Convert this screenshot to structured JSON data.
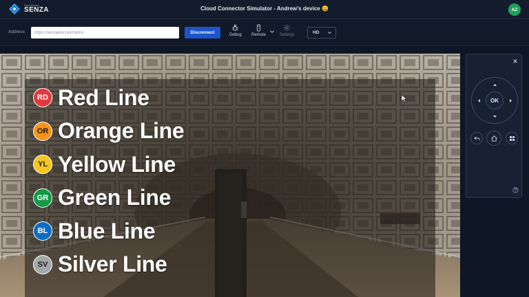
{
  "app": {
    "brand_small": "Synamedia",
    "brand": "SENZA",
    "title": "Cloud Connector Simulator - Andrew's device 😀",
    "user_initials": "AZ"
  },
  "toolbar": {
    "address_label": "Address",
    "address_value": "https://senzadev.net/metro/",
    "disconnect_label": "Disconnect",
    "debug_label": "Debug",
    "remote_label": "Remote",
    "settings_label": "Settings",
    "resolution": "HD"
  },
  "content": {
    "lines": [
      {
        "code": "RD",
        "name": "Red Line",
        "color": "#e03a3e",
        "text_dark": false
      },
      {
        "code": "OR",
        "name": "Orange Line",
        "color": "#f7931d",
        "text_dark": true
      },
      {
        "code": "YL",
        "name": "Yellow Line",
        "color": "#f5c621",
        "text_dark": true
      },
      {
        "code": "GR",
        "name": "Green Line",
        "color": "#139a47",
        "text_dark": false
      },
      {
        "code": "BL",
        "name": "Blue Line",
        "color": "#0b6dc2",
        "text_dark": false
      },
      {
        "code": "SV",
        "name": "Silver Line",
        "color": "#a3a8ab",
        "text_dark": true
      }
    ]
  },
  "remote": {
    "ok_label": "OK"
  },
  "colors": {
    "accent": "#1d55c8",
    "avatar": "#21a05a",
    "background": "#0f1726"
  }
}
